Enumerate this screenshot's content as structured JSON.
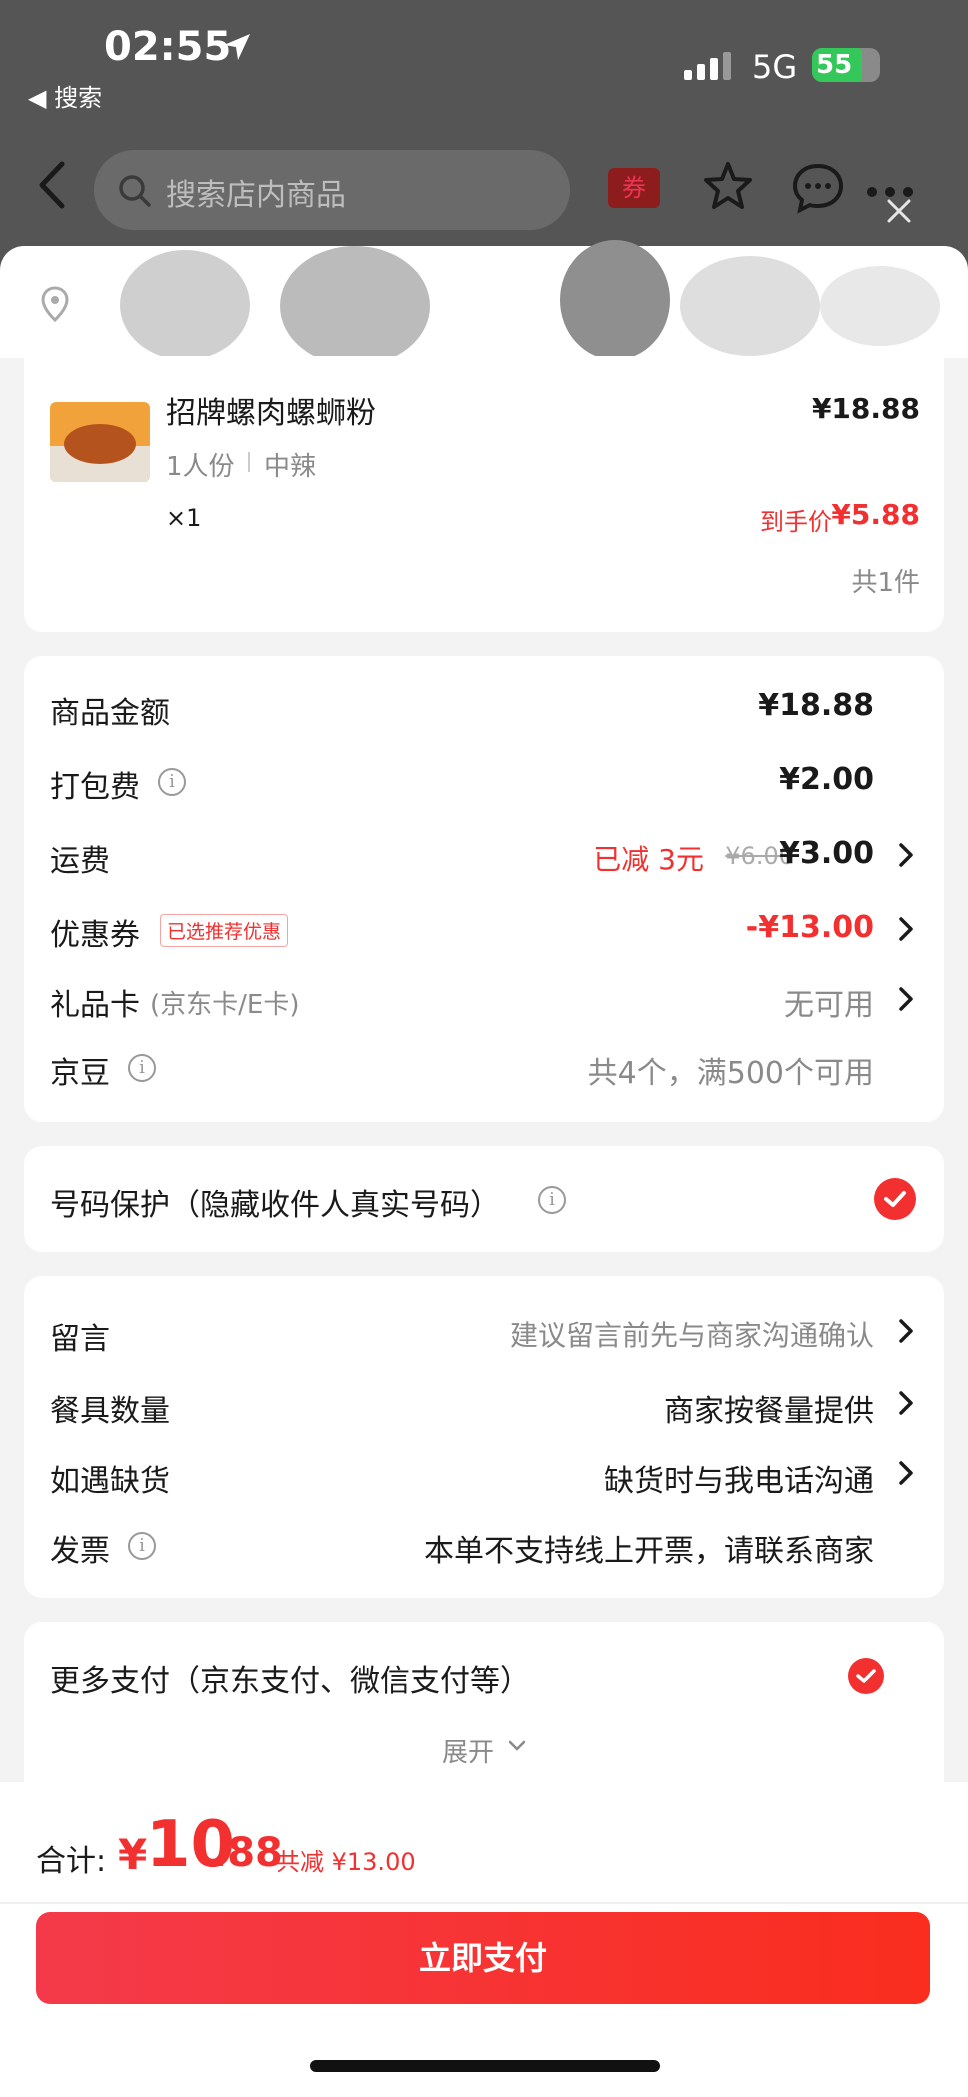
{
  "status_bar": {
    "time": "02:55",
    "back_app": "◀ 搜索",
    "network": "5G",
    "battery": "55"
  },
  "nav": {
    "search_placeholder": "搜索店内商品",
    "coupon_label": "券"
  },
  "product": {
    "name": "招牌螺肉螺蛳粉",
    "price": "¥18.88",
    "spec_portion": "1人份",
    "spec_spice": "中辣",
    "quantity": "×1",
    "final_price_label": "到手价",
    "final_price": "¥5.88",
    "total_count": "共1件"
  },
  "fees": {
    "goods_label": "商品金额",
    "goods_value": "¥18.88",
    "packing_label": "打包费",
    "packing_value": "¥2.00",
    "delivery_label": "运费",
    "delivery_discount": "已减 3元",
    "delivery_original": "¥6.00",
    "delivery_value": "¥3.00",
    "coupon_label": "优惠券",
    "coupon_tag": "已选推荐优惠",
    "coupon_value": "-¥13.00",
    "giftcard_label": "礼品卡",
    "giftcard_sub": "(京东卡/E卡)",
    "giftcard_value": "无可用",
    "beans_label": "京豆",
    "beans_value": "共4个，满500个可用"
  },
  "privacy": {
    "label": "号码保护（隐藏收件人真实号码）"
  },
  "options": {
    "note_label": "留言",
    "note_value": "建议留言前先与商家沟通确认",
    "utensils_label": "餐具数量",
    "utensils_value": "商家按餐量提供",
    "stockout_label": "如遇缺货",
    "stockout_value": "缺货时与我电话沟通",
    "invoice_label": "发票",
    "invoice_value": "本单不支持线上开票，请联系商家"
  },
  "payment": {
    "label": "更多支付（京东支付、微信支付等）",
    "expand": "展开"
  },
  "footer": {
    "total_label": "合计:",
    "currency": "¥",
    "total_int": "10",
    "total_dec": ".88",
    "saved": "共减 ¥13.00",
    "pay_button": "立即支付"
  },
  "colors": {
    "accent": "#f23030",
    "header": "#555555",
    "pay_gradient_start": "#f43a4a",
    "pay_gradient_end": "#fa2d1e"
  }
}
